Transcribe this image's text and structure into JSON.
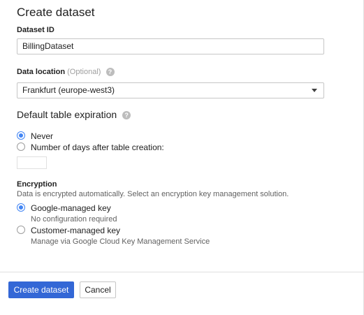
{
  "dialog": {
    "title": "Create dataset"
  },
  "dataset_id": {
    "label": "Dataset ID",
    "value": "BillingDataset"
  },
  "data_location": {
    "label": "Data location",
    "optional": "(Optional)",
    "selected": "Frankfurt (europe-west3)"
  },
  "expiration": {
    "title": "Default table expiration",
    "options": [
      {
        "label": "Never",
        "checked": true
      },
      {
        "label": "Number of days after table creation:",
        "checked": false
      }
    ],
    "days_value": ""
  },
  "encryption": {
    "title": "Encryption",
    "description": "Data is encrypted automatically. Select an encryption key management solution.",
    "options": [
      {
        "label": "Google-managed key",
        "sublabel": "No configuration required",
        "checked": true
      },
      {
        "label": "Customer-managed key",
        "sublabel": "Manage via Google Cloud Key Management Service",
        "checked": false
      }
    ]
  },
  "actions": {
    "create_label": "Create dataset",
    "cancel_label": "Cancel"
  },
  "icons": {
    "help": "help-icon",
    "dropdown": "chevron-down-icon"
  },
  "colors": {
    "primary": "#3367d6",
    "radio_checked": "#4285f4"
  }
}
